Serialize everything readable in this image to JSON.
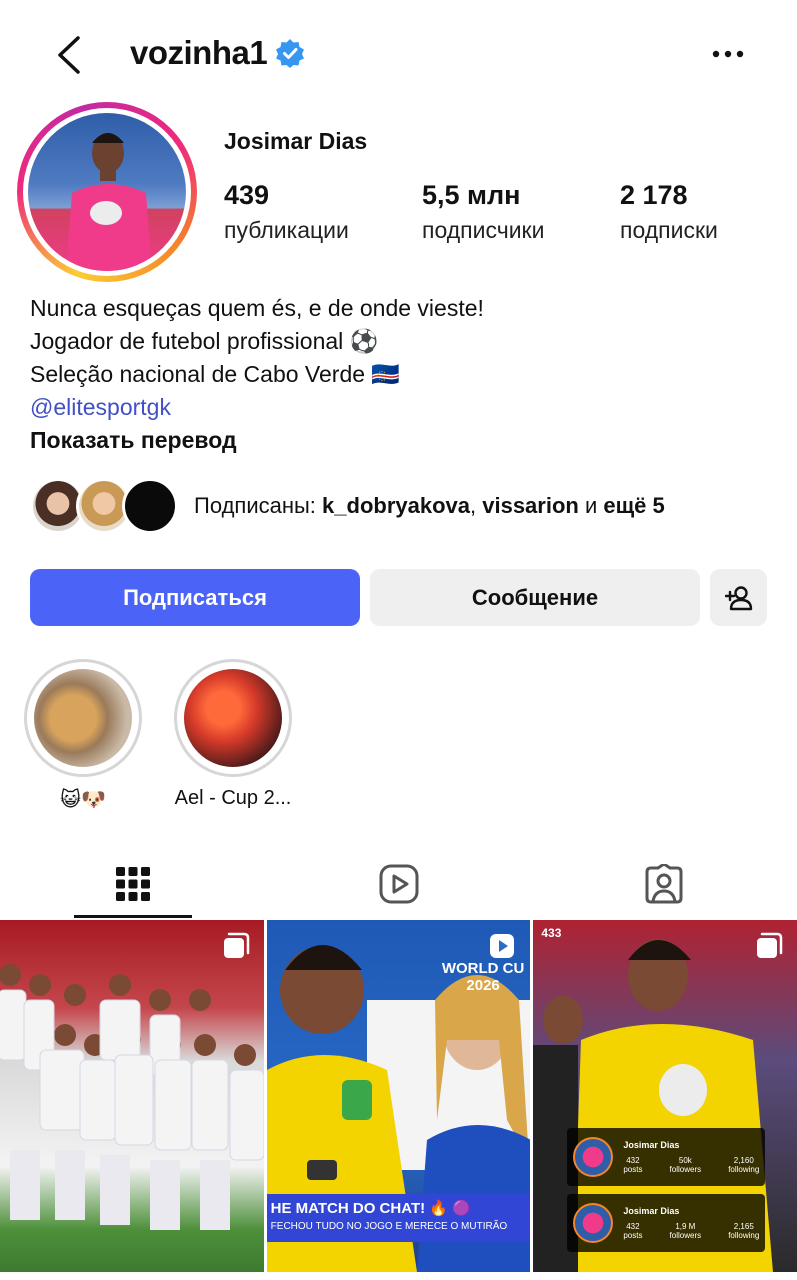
{
  "header": {
    "username": "vozinha1",
    "verified": true
  },
  "profile": {
    "full_name": "Josimar Dias",
    "stats": [
      {
        "value": "439",
        "label": "публикации"
      },
      {
        "value": "5,5 млн",
        "label": "подписчики"
      },
      {
        "value": "2 178",
        "label": "подписки"
      }
    ],
    "bio_lines": [
      "Nunca esqueças quem és, e de onde vieste!",
      "Jogador de futebol profissional ⚽",
      "Seleção nacional de Cabo Verde 🇨🇻"
    ],
    "bio_link": "@elitesportgk",
    "translate_label": "Показать перевод"
  },
  "followed_by": {
    "prefix": "Подписаны: ",
    "user1": "k_dobryakova",
    "sep": ", ",
    "user2": "vissarion",
    "suffix_word": " и ",
    "suffix_count": "ещё 5"
  },
  "actions": {
    "follow_label": "Подписаться",
    "message_label": "Сообщение",
    "add_icon": "add-person-icon"
  },
  "highlights": [
    {
      "label": "😺🐶"
    },
    {
      "label": "Ael - Cup 2..."
    }
  ],
  "tabs": [
    {
      "name": "grid",
      "icon": "grid-icon",
      "active": true
    },
    {
      "name": "reels",
      "icon": "reels-icon",
      "active": false
    },
    {
      "name": "tagged",
      "icon": "tagged-icon",
      "active": false
    }
  ],
  "posts": {
    "post1": {
      "type": "carousel"
    },
    "post2": {
      "type": "reel",
      "wc_line1": "WORLD CU",
      "wc_line2": "2026",
      "caption": "HE MATCH DO CHAT! 🔥 🟣",
      "caption_sub": "FECHOU TUDO NO JOGO E MERECE O MUTIRÃO"
    },
    "post3": {
      "type": "carousel",
      "brand": "433",
      "card1": {
        "name": "Josimar Dias",
        "posts": "432",
        "followers": "50k",
        "following": "2,160"
      },
      "card2": {
        "name": "Josimar Dias",
        "posts": "432",
        "followers": "1,9 M",
        "following": "2,165"
      },
      "labels": {
        "posts": "posts",
        "followers": "followers",
        "following": "following"
      }
    }
  },
  "colors": {
    "follow_button": "#4b63f6",
    "link": "#4150c6",
    "verified": "#3797f0"
  }
}
